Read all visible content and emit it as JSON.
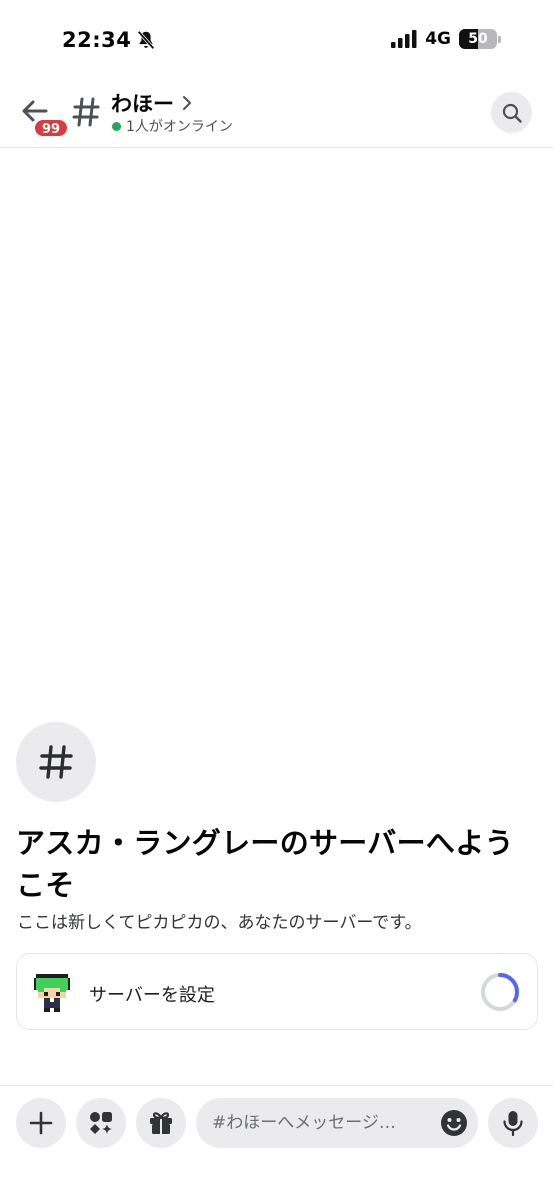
{
  "status_bar": {
    "time": "22:34",
    "network": "4G",
    "battery": "50",
    "battery_level": 0.5
  },
  "header": {
    "back_badge": "99",
    "channel_name": "わほー",
    "online_status": "1人がオンライン"
  },
  "welcome": {
    "title": "アスカ・ラングレーのサーバーへようこそ",
    "subtitle": "ここは新しくてピカピカの、あなたのサーバーです。",
    "setup_card": {
      "label": "サーバーを設定",
      "progress": 0.33
    }
  },
  "composer": {
    "placeholder": "#わほーへメッセージ…"
  },
  "colors": {
    "badge": "#d83c3e",
    "online": "#23a55a",
    "progress_accent": "#5865f2"
  }
}
